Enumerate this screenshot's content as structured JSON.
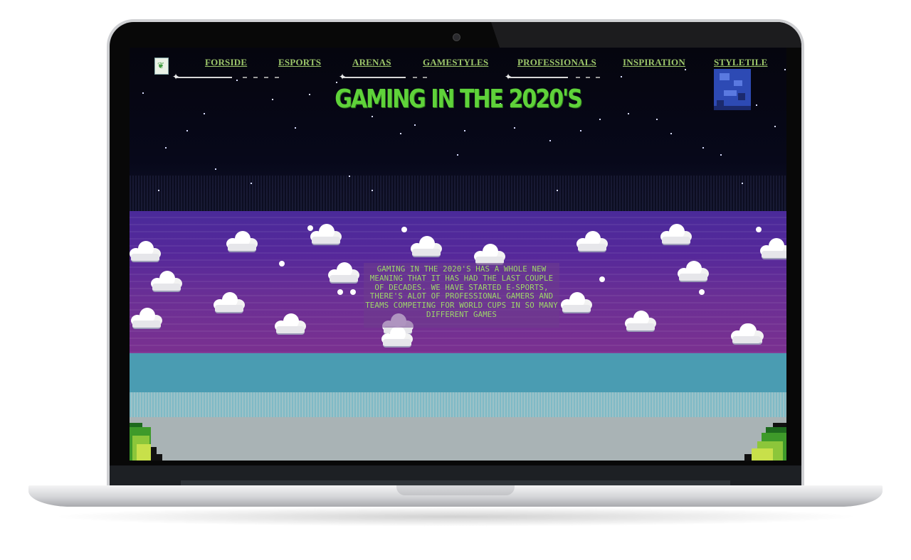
{
  "site": {
    "logo_icon": "leaf-logo-icon",
    "nav": [
      {
        "label": "FORSIDE"
      },
      {
        "label": "ESPORTS"
      },
      {
        "label": "ARENAS"
      },
      {
        "label": "GAMESTYLES"
      },
      {
        "label": "PROFESSIONALS"
      },
      {
        "label": "INSPIRATION"
      },
      {
        "label": "STYLETILE"
      }
    ],
    "title": "GAMING IN THE 2020'S",
    "intro_text": "GAMING IN THE 2020'S HAS A WHOLE NEW MEANING THAT IT HAS HAD THE LAST COUPLE OF DECADES. WE HAVE STARTED E-SPORTS, THERE'S ALOT OF PROFESSIONAL GAMERS AND TEAMS COMPETING FOR WORLD CUPS IN SO MANY DIFFERENT GAMES"
  },
  "colors": {
    "accent_green": "#5fd23a",
    "nav_green": "#9cc66a",
    "night_sky": "#05050e",
    "purple_band": "#55289a",
    "teal_band": "#4a9cb2",
    "gray_ground": "#a9b3b5",
    "moon_blue": "#2d4ab4"
  },
  "decor": {
    "moon_icon": "pixel-moon-icon",
    "cloud_icon": "pixel-cloud-icon",
    "bush_icon": "pixel-bush-icon",
    "divider_icon": "sparkle-divider-icon"
  }
}
